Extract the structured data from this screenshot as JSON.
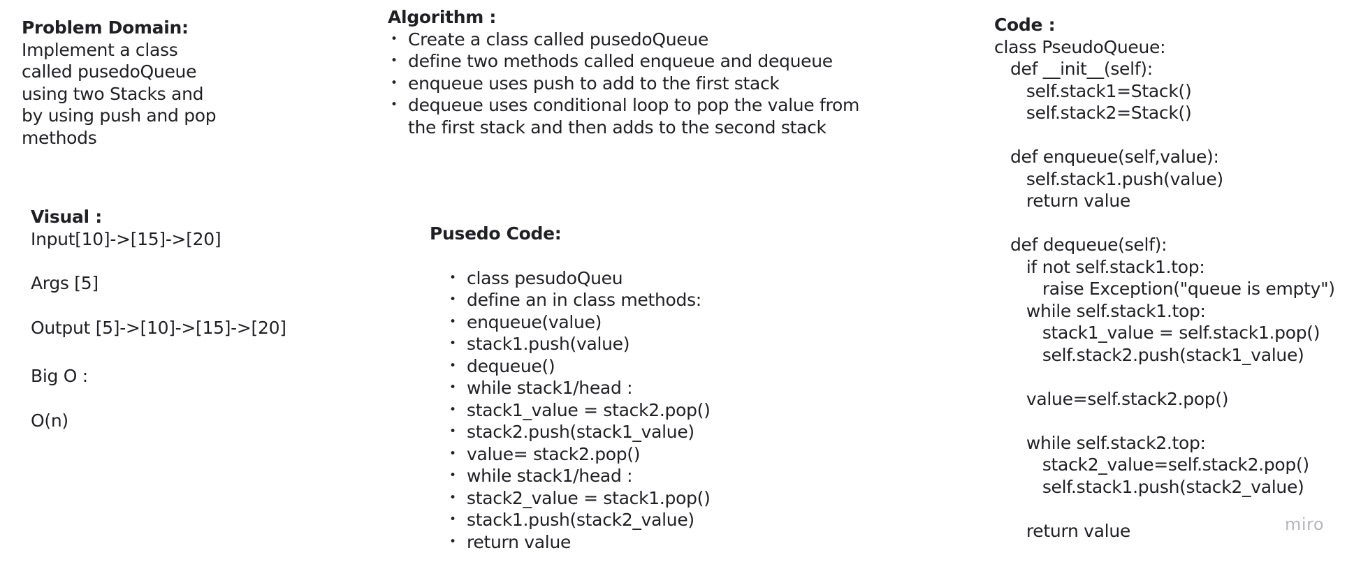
{
  "problem_domain": {
    "heading": "Problem Domain:",
    "lines": [
      "Implement a class",
      "called pusedoQueue",
      "using two Stacks and",
      "by using push and pop",
      "methods"
    ]
  },
  "algorithm": {
    "heading": "Algorithm :",
    "items": [
      "Create a class called pusedoQueue",
      "define two methods called enqueue and dequeue",
      "enqueue uses push to add to the first stack",
      "dequeue uses conditional loop to pop the value from the first stack and then adds to the second stack"
    ]
  },
  "visual": {
    "heading": "Visual :",
    "input": "Input[10]->[15]->[20]",
    "args": "Args [5]",
    "output": "Output [5]->[10]->[15]->[20]",
    "big_o_label": "Big O :",
    "big_o_value": "O(n)"
  },
  "pseudo_code": {
    "heading": "Pusedo Code:",
    "items": [
      "class pesudoQueu",
      "define an in class methods:",
      "enqueue(value)",
      "stack1.push(value)",
      "dequeue()",
      "while stack1/head :",
      "stack1_value = stack2.pop()",
      "stack2.push(stack1_value)",
      "value= stack2.pop()",
      "while stack1/head :",
      "stack2_value = stack1.pop()",
      "stack1.push(stack2_value)",
      "return value"
    ]
  },
  "code": {
    "heading": "Code :",
    "lines": [
      "class PseudoQueue:",
      "   def __init__(self):",
      "      self.stack1=Stack()",
      "      self.stack2=Stack()",
      "",
      "   def enqueue(self,value):",
      "      self.stack1.push(value)",
      "      return value",
      "",
      "   def dequeue(self):",
      "      if not self.stack1.top:",
      "         raise Exception(\"queue is empty\")",
      "      while self.stack1.top:",
      "         stack1_value = self.stack1.pop()",
      "         self.stack2.push(stack1_value)",
      "",
      "      value=self.stack2.pop()",
      "",
      "      while self.stack2.top:",
      "         stack2_value=self.stack2.pop()",
      "         self.stack1.push(stack2_value)",
      "",
      "      return value"
    ]
  },
  "watermark": "miro"
}
